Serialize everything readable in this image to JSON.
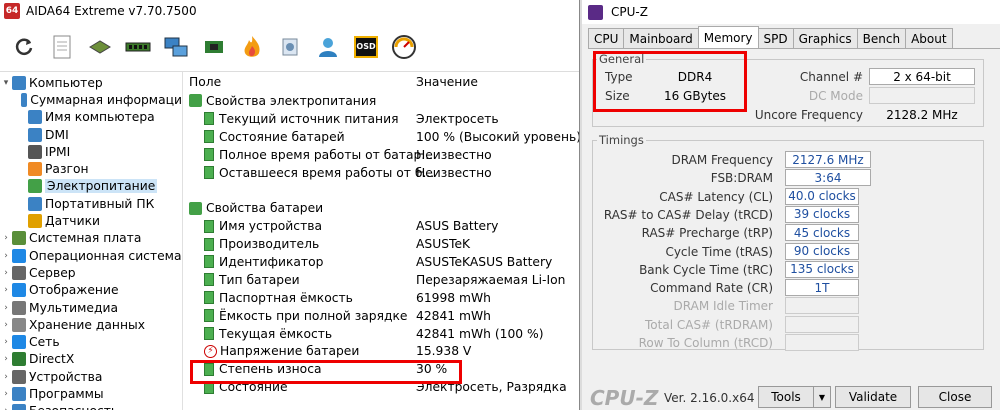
{
  "aida": {
    "title": "AIDA64 Extreme v7.70.7500",
    "logo": "64",
    "toolbar": [
      "refresh-icon",
      "report-icon",
      "motherboard-icon",
      "memory-module-icon",
      "network-icon",
      "chip-icon",
      "fire-icon",
      "tools-icon",
      "user-icon",
      "osd-icon",
      "gauge-icon"
    ],
    "osd_label": "OSD",
    "tree": [
      {
        "label": "Компьютер",
        "level": 0,
        "exp": "▾",
        "icon": "computer-icon",
        "color": "#3b82c4"
      },
      {
        "label": "Суммарная информаци",
        "level": 1,
        "exp": "",
        "icon": "computer-icon",
        "color": "#3b82c4"
      },
      {
        "label": "Имя компьютера",
        "level": 1,
        "exp": "",
        "icon": "computer-icon",
        "color": "#3b82c4"
      },
      {
        "label": "DMI",
        "level": 1,
        "exp": "",
        "icon": "dmi-icon",
        "color": "#3b82c4"
      },
      {
        "label": "IPMI",
        "level": 1,
        "exp": "",
        "icon": "ipmi-icon",
        "color": "#555"
      },
      {
        "label": "Разгон",
        "level": 1,
        "exp": "",
        "icon": "fire-icon",
        "color": "#f08a24"
      },
      {
        "label": "Электропитание",
        "level": 1,
        "exp": "",
        "icon": "power-icon",
        "color": "#43a047",
        "selected": true
      },
      {
        "label": "Портативный ПК",
        "level": 1,
        "exp": "",
        "icon": "laptop-icon",
        "color": "#3b82c4"
      },
      {
        "label": "Датчики",
        "level": 1,
        "exp": "",
        "icon": "gauge-icon",
        "color": "#e0a000"
      },
      {
        "label": "Системная плата",
        "level": 0,
        "exp": "›",
        "icon": "motherboard-icon",
        "color": "#5a8f3a"
      },
      {
        "label": "Операционная система",
        "level": 0,
        "exp": "›",
        "icon": "windows-icon",
        "color": "#1e88e5"
      },
      {
        "label": "Сервер",
        "level": 0,
        "exp": "›",
        "icon": "server-icon",
        "color": "#666"
      },
      {
        "label": "Отображение",
        "level": 0,
        "exp": "›",
        "icon": "display-icon",
        "color": "#1e88e5"
      },
      {
        "label": "Мультимедиа",
        "level": 0,
        "exp": "›",
        "icon": "multimedia-icon",
        "color": "#777"
      },
      {
        "label": "Хранение данных",
        "level": 0,
        "exp": "›",
        "icon": "storage-icon",
        "color": "#888"
      },
      {
        "label": "Сеть",
        "level": 0,
        "exp": "›",
        "icon": "network-icon",
        "color": "#1e88e5"
      },
      {
        "label": "DirectX",
        "level": 0,
        "exp": "›",
        "icon": "directx-icon",
        "color": "#2e7d32"
      },
      {
        "label": "Устройства",
        "level": 0,
        "exp": "›",
        "icon": "devices-icon",
        "color": "#666"
      },
      {
        "label": "Программы",
        "level": 0,
        "exp": "›",
        "icon": "programs-icon",
        "color": "#3b82c4"
      },
      {
        "label": "Безопасность",
        "level": 0,
        "exp": "›",
        "icon": "security-icon",
        "color": "#3b82c4"
      }
    ],
    "list_header": {
      "field": "Поле",
      "value": "Значение"
    },
    "rows": [
      {
        "type": "group",
        "field": "Свойства электропитания",
        "value": ""
      },
      {
        "type": "item",
        "field": "Текущий источник питания",
        "value": "Электросеть"
      },
      {
        "type": "item",
        "field": "Состояние батарей",
        "value": "100 % (Высокий уровень)"
      },
      {
        "type": "item",
        "field": "Полное время работы от батар...",
        "value": "Неизвестно"
      },
      {
        "type": "item",
        "field": "Оставшееся время работы от б...",
        "value": "Неизвестно"
      },
      {
        "type": "blank",
        "field": "",
        "value": ""
      },
      {
        "type": "group",
        "field": "Свойства батареи",
        "value": ""
      },
      {
        "type": "item",
        "field": "Имя устройства",
        "value": "ASUS Battery"
      },
      {
        "type": "item",
        "field": "Производитель",
        "value": "ASUSTeK"
      },
      {
        "type": "item",
        "field": "Идентификатор",
        "value": "ASUSTeKASUS Battery"
      },
      {
        "type": "item",
        "field": "Тип батареи",
        "value": "Перезаряжаемая Li-Ion"
      },
      {
        "type": "item",
        "field": "Паспортная ёмкость",
        "value": "61998 mWh"
      },
      {
        "type": "item",
        "field": "Ёмкость при полной зарядке",
        "value": "42841 mWh"
      },
      {
        "type": "item",
        "field": "Текущая ёмкость",
        "value": "42841 mWh  (100 %)"
      },
      {
        "type": "voltage",
        "field": "Напряжение батареи",
        "value": "15.938 V"
      },
      {
        "type": "item",
        "field": "Степень износа",
        "value": "30 %"
      },
      {
        "type": "item",
        "field": "Состояние",
        "value": "Электросеть, Разрядка"
      }
    ]
  },
  "cpuz": {
    "title": "CPU-Z",
    "tabs": [
      "CPU",
      "Mainboard",
      "Memory",
      "SPD",
      "Graphics",
      "Bench",
      "About"
    ],
    "active_tab": "Memory",
    "general": {
      "title": "General",
      "type_label": "Type",
      "type": "DDR4",
      "size_label": "Size",
      "size": "16 GBytes",
      "channel_label": "Channel #",
      "channel": "2 x 64-bit",
      "dcmode_label": "DC Mode",
      "dcmode": "",
      "uncore_label": "Uncore Frequency",
      "uncore": "2128.2 MHz"
    },
    "timings": {
      "title": "Timings",
      "rows": [
        {
          "label": "DRAM Frequency",
          "value": "2127.6 MHz",
          "disabled": false
        },
        {
          "label": "FSB:DRAM",
          "value": "3:64",
          "disabled": false
        },
        {
          "label": "CAS# Latency (CL)",
          "value": "40.0 clocks",
          "disabled": false
        },
        {
          "label": "RAS# to CAS# Delay (tRCD)",
          "value": "39 clocks",
          "disabled": false
        },
        {
          "label": "RAS# Precharge (tRP)",
          "value": "45 clocks",
          "disabled": false
        },
        {
          "label": "Cycle Time (tRAS)",
          "value": "90 clocks",
          "disabled": false
        },
        {
          "label": "Bank Cycle Time (tRC)",
          "value": "135 clocks",
          "disabled": false
        },
        {
          "label": "Command Rate (CR)",
          "value": "1T",
          "disabled": false
        },
        {
          "label": "DRAM Idle Timer",
          "value": "",
          "disabled": true
        },
        {
          "label": "Total CAS# (tRDRAM)",
          "value": "",
          "disabled": true
        },
        {
          "label": "Row To Column (tRCD)",
          "value": "",
          "disabled": true
        }
      ]
    },
    "brand": "CPU-Z",
    "version": "Ver. 2.16.0.x64",
    "buttons": {
      "tools": "Tools",
      "validate": "Validate",
      "close": "Close",
      "dropdown": "▼"
    }
  },
  "colors": {
    "highlight": "#e00000",
    "selection": "#cce4f7",
    "link_blue": "#1f4fa0"
  }
}
